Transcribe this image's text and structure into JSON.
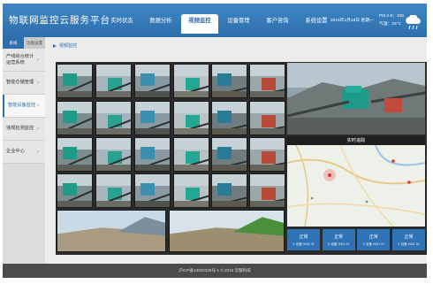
{
  "app": {
    "title": "物联网监控云服务平台"
  },
  "nav": {
    "items": [
      {
        "label": "实时状态"
      },
      {
        "label": "数据分析"
      },
      {
        "label": "视频监控",
        "active": true
      },
      {
        "label": "设备管理"
      },
      {
        "label": "客户咨询"
      },
      {
        "label": "系统设置"
      }
    ]
  },
  "header": {
    "datetime": "2016年1月18日 星期一",
    "pm": "PM 2.5：100",
    "temp": "气温：23°C",
    "weather_icon": "rain-cloud-icon"
  },
  "sidebar": {
    "tabs": [
      {
        "label": "系统",
        "active": true
      },
      {
        "label": "功能设置"
      }
    ],
    "items": [
      {
        "label": "产线综合统计运营系统"
      },
      {
        "label": "智能仓储管理"
      },
      {
        "label": "智能设备监控",
        "active": true
      },
      {
        "label": "违规检测监控"
      },
      {
        "label": "企业中心"
      }
    ]
  },
  "breadcrumb": {
    "label": "视频监控"
  },
  "map": {
    "title": "实时追踪"
  },
  "status_cards": [
    {
      "label": "正常",
      "sub": "X 设备 0001 01"
    },
    {
      "label": "正常",
      "sub": "X 设备 0001 01"
    },
    {
      "label": "正常",
      "sub": "X 设备 0001 01"
    },
    {
      "label": "正常",
      "sub": "X 设备 0001 01"
    }
  ],
  "footer": {
    "text": "沪ICP备13003335号-1 © 2016 云服科技"
  },
  "colors": {
    "header": "#2e6fad",
    "active_nav_bg": "#ffffff",
    "main_bg": "#2b2b2b",
    "status_card": "#2f73b6",
    "footer": "#4b4b4b"
  }
}
